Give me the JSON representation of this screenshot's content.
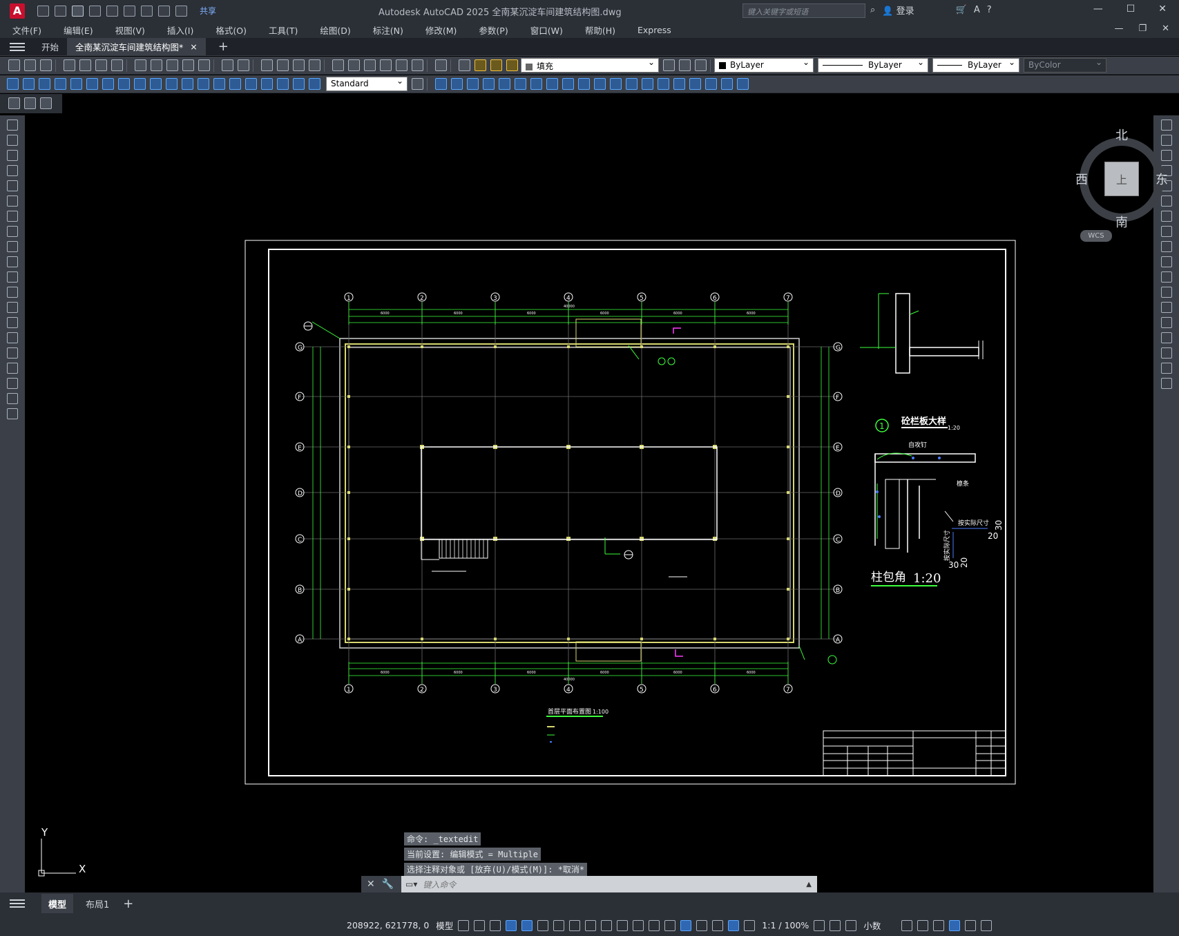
{
  "window": {
    "app_letter": "A",
    "share_label": "共享",
    "title": "Autodesk AutoCAD 2025    全南某沉淀车间建筑结构图.dwg",
    "search_placeholder": "键入关键字或短语",
    "login_label": "登录",
    "help_label": "?"
  },
  "menu": [
    "文件(F)",
    "编辑(E)",
    "视图(V)",
    "插入(I)",
    "格式(O)",
    "工具(T)",
    "绘图(D)",
    "标注(N)",
    "修改(M)",
    "参数(P)",
    "窗口(W)",
    "帮助(H)",
    "Express"
  ],
  "tabs": {
    "start": "开始",
    "doc": "全南某沉淀车间建筑结构图*",
    "close": "×",
    "add": "+"
  },
  "toolbar": {
    "layer_value": "填充",
    "color_value": "ByLayer",
    "linetype_value": "ByLayer",
    "lineweight_value": "ByLayer",
    "plotstyle_value": "ByColor",
    "textstyle_value": "Standard"
  },
  "viewcube": {
    "north": "北",
    "south": "南",
    "west": "西",
    "east": "东",
    "face": "上",
    "ucs": "WCS"
  },
  "drawing": {
    "axis_numbers": [
      "1",
      "2",
      "3",
      "4",
      "5",
      "6",
      "7"
    ],
    "axis_letters": [
      "G",
      "F",
      "E",
      "D",
      "C",
      "B",
      "A"
    ],
    "total_dim": "40000",
    "bay_dim": "6000",
    "detail1_title": "砼栏板大样",
    "detail1_scale": "1:20",
    "detail1_no": "1",
    "detail2_title": "柱包角",
    "detail2_scale": "1:20",
    "plan_title": "首层平面布置图",
    "plan_scale": "1:100",
    "note_self_tap": "自攻钉",
    "note_purlin": "檩条",
    "note_size1": "按实际尺寸",
    "note_size2": "按实际尺寸",
    "dim_30a": "30",
    "dim_20a": "20",
    "dim_30b": "30",
    "dim_20b": "20",
    "ucs_x": "X",
    "ucs_y": "Y"
  },
  "command": {
    "history": [
      "命令: _textedit",
      "当前设置: 编辑模式 = Multiple",
      "选择注释对象或 [放弃(U)/模式(M)]: *取消*"
    ],
    "placeholder": "键入命令"
  },
  "layouts": {
    "model": "模型",
    "layout1": "布局1",
    "add": "+"
  },
  "status": {
    "coords": "208922, 621778, 0",
    "space": "模型",
    "scale": "1:1 / 100%",
    "units": "小数"
  }
}
